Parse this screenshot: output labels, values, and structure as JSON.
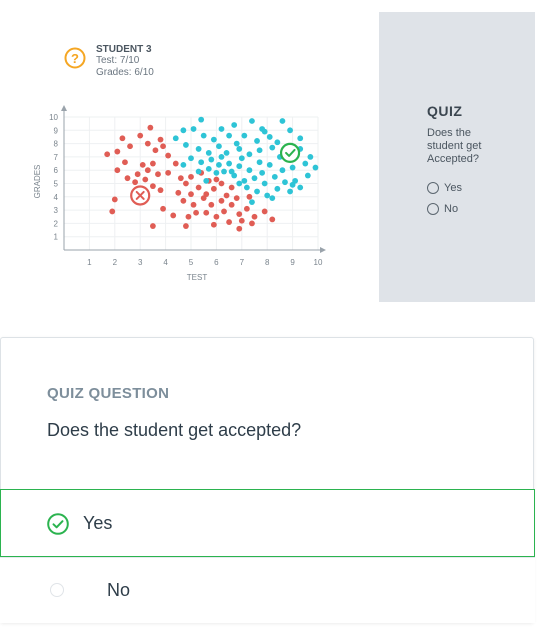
{
  "figure": {
    "student_label": "STUDENT 3",
    "test_line": "Test: 7/10",
    "grades_line": "Grades: 6/10",
    "question_badge_icon": "question-icon",
    "accepted_marker_icon": "check-icon",
    "rejected_marker_icon": "x-icon"
  },
  "chart_data": {
    "type": "scatter",
    "xlabel": "TEST",
    "ylabel": "GRADES",
    "xlim": [
      0,
      10
    ],
    "ylim": [
      0,
      10
    ],
    "x_ticks": [
      "1",
      "2",
      "3",
      "4",
      "5",
      "6",
      "7",
      "8",
      "9",
      "10"
    ],
    "y_ticks": [
      "1",
      "2",
      "3",
      "4",
      "5",
      "6",
      "7",
      "8",
      "9",
      "10"
    ],
    "grid": true,
    "series": [
      {
        "color": "#e05d55",
        "points": [
          [
            1.7,
            7.2
          ],
          [
            2.1,
            7.4
          ],
          [
            2.4,
            6.6
          ],
          [
            2.1,
            6.0
          ],
          [
            2.5,
            5.4
          ],
          [
            2.8,
            5.1
          ],
          [
            3.1,
            6.4
          ],
          [
            3.3,
            6.0
          ],
          [
            3.5,
            6.5
          ],
          [
            3.7,
            5.7
          ],
          [
            3.2,
            5.3
          ],
          [
            2.9,
            5.7
          ],
          [
            3.0,
            4.6
          ],
          [
            3.5,
            4.8
          ],
          [
            3.8,
            4.5
          ],
          [
            3.3,
            8.0
          ],
          [
            3.6,
            7.5
          ],
          [
            3.9,
            7.8
          ],
          [
            2.6,
            7.8
          ],
          [
            2.3,
            8.4
          ],
          [
            3.4,
            9.2
          ],
          [
            3.0,
            8.6
          ],
          [
            3.8,
            8.3
          ],
          [
            4.1,
            7.1
          ],
          [
            4.4,
            6.5
          ],
          [
            4.1,
            5.8
          ],
          [
            4.6,
            5.4
          ],
          [
            4.8,
            5.0
          ],
          [
            5.0,
            5.5
          ],
          [
            5.4,
            5.8
          ],
          [
            5.7,
            5.2
          ],
          [
            6.0,
            5.3
          ],
          [
            5.9,
            4.6
          ],
          [
            5.3,
            4.7
          ],
          [
            5.0,
            4.2
          ],
          [
            4.7,
            3.7
          ],
          [
            5.1,
            3.4
          ],
          [
            5.5,
            3.9
          ],
          [
            5.8,
            3.4
          ],
          [
            6.2,
            3.7
          ],
          [
            6.3,
            2.9
          ],
          [
            6.6,
            3.4
          ],
          [
            6.9,
            2.7
          ],
          [
            7.0,
            2.2
          ],
          [
            6.5,
            2.1
          ],
          [
            6.0,
            2.5
          ],
          [
            5.6,
            2.8
          ],
          [
            5.2,
            2.8
          ],
          [
            4.9,
            2.5
          ],
          [
            4.3,
            2.6
          ],
          [
            3.9,
            3.1
          ],
          [
            4.5,
            4.3
          ],
          [
            5.6,
            4.2
          ],
          [
            6.4,
            4.1
          ],
          [
            6.8,
            3.9
          ],
          [
            7.2,
            3.1
          ],
          [
            7.5,
            2.5
          ],
          [
            7.9,
            2.9
          ],
          [
            8.2,
            2.3
          ],
          [
            6.2,
            5.0
          ],
          [
            6.6,
            4.7
          ],
          [
            7.3,
            4.0
          ],
          [
            2.0,
            3.8
          ],
          [
            1.9,
            2.9
          ],
          [
            3.5,
            1.8
          ],
          [
            4.8,
            1.8
          ],
          [
            5.9,
            1.9
          ],
          [
            6.9,
            1.6
          ],
          [
            7.4,
            2.0
          ]
        ]
      },
      {
        "color": "#2ec4d6",
        "points": [
          [
            5.4,
            9.8
          ],
          [
            6.7,
            9.4
          ],
          [
            7.4,
            9.7
          ],
          [
            7.8,
            9.1
          ],
          [
            8.6,
            9.7
          ],
          [
            8.9,
            9.0
          ],
          [
            9.3,
            8.4
          ],
          [
            8.1,
            8.5
          ],
          [
            7.6,
            8.2
          ],
          [
            7.1,
            8.6
          ],
          [
            6.5,
            8.6
          ],
          [
            6.2,
            9.1
          ],
          [
            5.9,
            8.3
          ],
          [
            5.5,
            8.6
          ],
          [
            5.1,
            9.1
          ],
          [
            4.7,
            9.0
          ],
          [
            4.4,
            8.4
          ],
          [
            4.8,
            7.9
          ],
          [
            5.3,
            7.6
          ],
          [
            5.7,
            7.3
          ],
          [
            6.1,
            7.8
          ],
          [
            6.4,
            7.3
          ],
          [
            6.9,
            7.6
          ],
          [
            7.3,
            7.2
          ],
          [
            7.7,
            7.5
          ],
          [
            8.2,
            7.7
          ],
          [
            8.5,
            7.0
          ],
          [
            8.9,
            7.2
          ],
          [
            9.3,
            7.6
          ],
          [
            9.5,
            6.5
          ],
          [
            9.0,
            6.2
          ],
          [
            8.6,
            6.0
          ],
          [
            8.1,
            6.4
          ],
          [
            7.7,
            6.6
          ],
          [
            7.3,
            6.0
          ],
          [
            6.9,
            6.3
          ],
          [
            6.5,
            6.5
          ],
          [
            6.1,
            6.4
          ],
          [
            5.8,
            6.8
          ],
          [
            5.4,
            6.6
          ],
          [
            5.0,
            6.9
          ],
          [
            4.7,
            6.4
          ],
          [
            5.3,
            5.9
          ],
          [
            6.0,
            5.8
          ],
          [
            6.7,
            5.6
          ],
          [
            7.1,
            5.2
          ],
          [
            7.5,
            5.4
          ],
          [
            7.9,
            5.0
          ],
          [
            8.3,
            5.5
          ],
          [
            8.7,
            5.1
          ],
          [
            9.1,
            5.2
          ],
          [
            9.3,
            4.7
          ],
          [
            8.9,
            4.4
          ],
          [
            8.4,
            4.6
          ],
          [
            8.0,
            4.1
          ],
          [
            7.6,
            4.4
          ],
          [
            7.2,
            4.7
          ],
          [
            6.9,
            5.0
          ],
          [
            6.3,
            5.9
          ],
          [
            5.7,
            6.1
          ],
          [
            6.8,
            8.0
          ],
          [
            7.9,
            8.9
          ],
          [
            8.4,
            8.1
          ],
          [
            9.7,
            7.0
          ],
          [
            9.9,
            6.2
          ],
          [
            9.6,
            5.6
          ],
          [
            8.2,
            3.9
          ],
          [
            7.4,
            3.6
          ],
          [
            9.0,
            4.9
          ],
          [
            5.6,
            5.2
          ],
          [
            6.2,
            7.0
          ],
          [
            7.0,
            6.9
          ],
          [
            7.8,
            5.8
          ],
          [
            6.6,
            5.9
          ]
        ]
      }
    ],
    "highlight_accepted": [
      8.9,
      7.3
    ],
    "highlight_rejected": [
      3.0,
      4.1
    ]
  },
  "side_panel": {
    "title": "QUIZ",
    "question": "Does the student get Accepted?",
    "option_yes": "Yes",
    "option_no": "No"
  },
  "quiz": {
    "label": "QUIZ QUESTION",
    "question": "Does the student get accepted?",
    "options": [
      {
        "label": "Yes",
        "selected": true
      },
      {
        "label": "No",
        "selected": false
      }
    ]
  },
  "colors": {
    "accepted": "#2ec4d6",
    "rejected": "#e05d55",
    "correct_green": "#2bb34f",
    "badge_orange": "#f5a623"
  }
}
